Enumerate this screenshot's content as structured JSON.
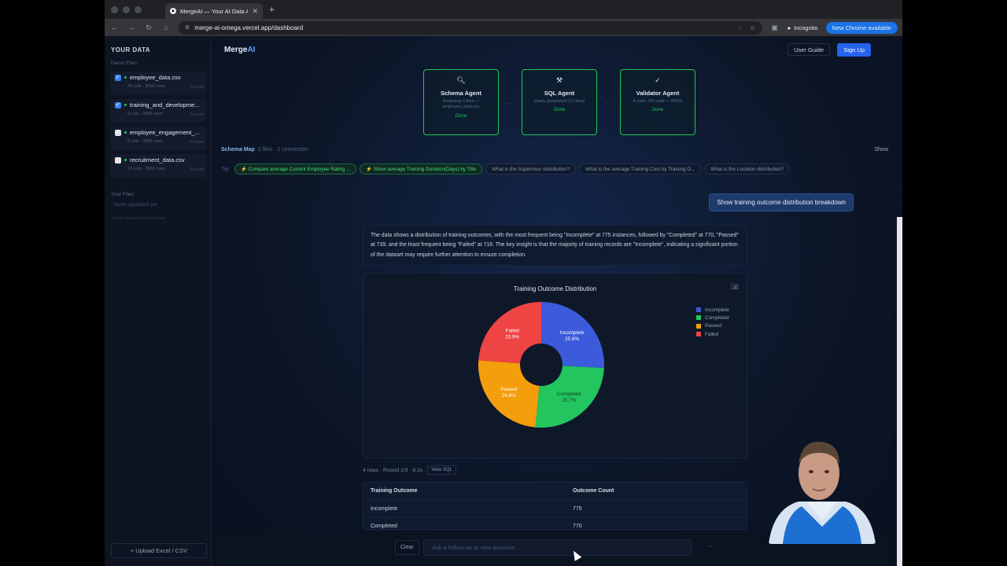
{
  "browser": {
    "tab_title": "MergeAI — Your AI Data Analy",
    "url": "merge-ai-omega.vercel.app/dashboard",
    "incognito_label": "Incognito",
    "update_label": "New Chrome available"
  },
  "sidebar": {
    "title": "YOUR DATA",
    "demo_label": "Demo Files",
    "files": [
      {
        "name": "employee_data.csv",
        "meta": "26 cols · 3000 rows",
        "checked": true,
        "preview": "Preview"
      },
      {
        "name": "training_and_developme...",
        "meta": "9 cols · 3000 rows",
        "checked": true,
        "preview": "Preview"
      },
      {
        "name": "employee_engagement_...",
        "meta": "5 cols · 3000 rows",
        "checked": false,
        "preview": "Preview"
      },
      {
        "name": "recruitment_data.csv",
        "meta": "18 cols · 3000 rows",
        "checked": false,
        "preview": "Preview"
      }
    ],
    "your_files_label": "Your Files",
    "none_uploaded": "None uploaded yet",
    "selected_note": "2/4 files selected for Schema Map",
    "upload_label": "+ Upload Excel / CSV"
  },
  "header": {
    "logo_main": "Merge",
    "logo_ai": "AI",
    "user_guide": "User Guide",
    "sign_up": "Sign Up"
  },
  "agents": [
    {
      "name": "Schema Agent",
      "desc": "Analyzing 4 files — employee_data.csv",
      "status": "Done",
      "icon": "magnifier-icon"
    },
    {
      "name": "SQL Agent",
      "desc": "Query generated (11 lines)",
      "status": "Done",
      "icon": "hammer-icon"
    },
    {
      "name": "Validator Agent",
      "desc": "4 rows, 0% nulls — PASS",
      "status": "Done",
      "icon": "checkmark-icon"
    }
  ],
  "schema_map": {
    "label": "Schema Map",
    "meta": "2 files · 1 connection",
    "toggle": "Show"
  },
  "suggestions": {
    "label": "Try:",
    "chips": [
      {
        "text": "⚡ Compare average Current Employee Rating ...",
        "highlight": true
      },
      {
        "text": "⚡ Show average Training Duration(Days) by Title",
        "highlight": true
      },
      {
        "text": "What is the Supervisor distribution?",
        "highlight": false
      },
      {
        "text": "What is the average Training Cost by Training O...",
        "highlight": false
      },
      {
        "text": "What is the Location distribution?",
        "highlight": false
      }
    ]
  },
  "conversation": {
    "question": "Show training outcome distribution breakdown",
    "answer": "The data shows a distribution of training outcomes, with the most frequent being \"Incomplete\" at 775 instances, followed by \"Completed\" at 770, \"Passed\" at 739, and the least frequent being \"Failed\" at 716. The key insight is that the majority of training records are \"Incomplete\", indicating a significant portion of the dataset may require further attention to ensure completion."
  },
  "chart_data": {
    "type": "pie",
    "title": "Training Outcome Distribution",
    "categories": [
      "Incomplete",
      "Completed",
      "Passed",
      "Failed"
    ],
    "values": [
      775,
      770,
      739,
      716
    ],
    "percent_labels": [
      "25.8%",
      "25.7%",
      "24.6%",
      "23.9%"
    ],
    "colors": [
      "#3b5bdb",
      "#22c55e",
      "#f59e0b",
      "#ef4444"
    ],
    "donut": true,
    "legend_position": "right"
  },
  "result": {
    "row_info": "4 rows · Round 1/3 · 6.1s",
    "view_sql": "View SQL",
    "columns": [
      "Training Outcome",
      "Outcome Count"
    ],
    "rows": [
      [
        "Incomplete",
        "775"
      ],
      [
        "Completed",
        "770"
      ]
    ]
  },
  "composer": {
    "clear": "Clear",
    "placeholder": "Ask a follow-up or new question...",
    "send_icon": "arrow-right-icon"
  }
}
